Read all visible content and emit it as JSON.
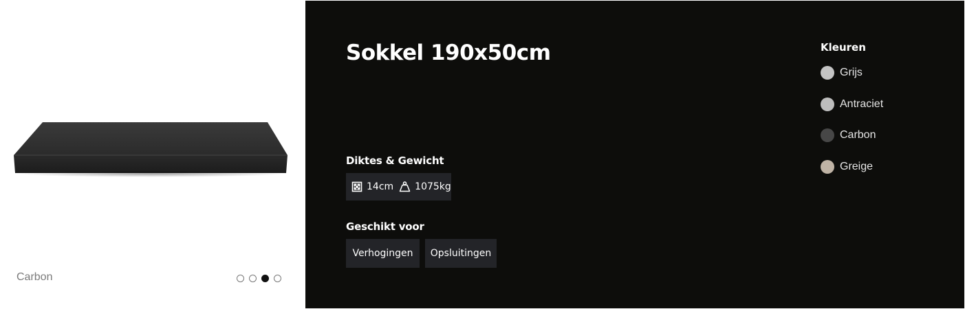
{
  "product": {
    "title": "Sokkel 190x50cm",
    "image_variant": "Carbon",
    "carousel": {
      "count": 4,
      "active_index": 2
    }
  },
  "specs": {
    "label": "Diktes & Gewicht",
    "thickness": "14cm",
    "weight": "1075kg",
    "thickness_icon": "resize-arrows-icon",
    "weight_icon": "weight-icon"
  },
  "suitable": {
    "label": "Geschikt voor",
    "tags": [
      "Verhogingen",
      "Opsluitingen"
    ]
  },
  "colors": {
    "label": "Kleuren",
    "options": [
      {
        "name": "Grijs",
        "hex": "#c4c4c4"
      },
      {
        "name": "Antraciet",
        "hex": "#bdbdbd"
      },
      {
        "name": "Carbon",
        "hex": "#474747"
      },
      {
        "name": "Greige",
        "hex": "#bfb3a5"
      }
    ]
  },
  "theme": {
    "panel_bg": "#0d0d0b",
    "box_bg": "#232428"
  }
}
